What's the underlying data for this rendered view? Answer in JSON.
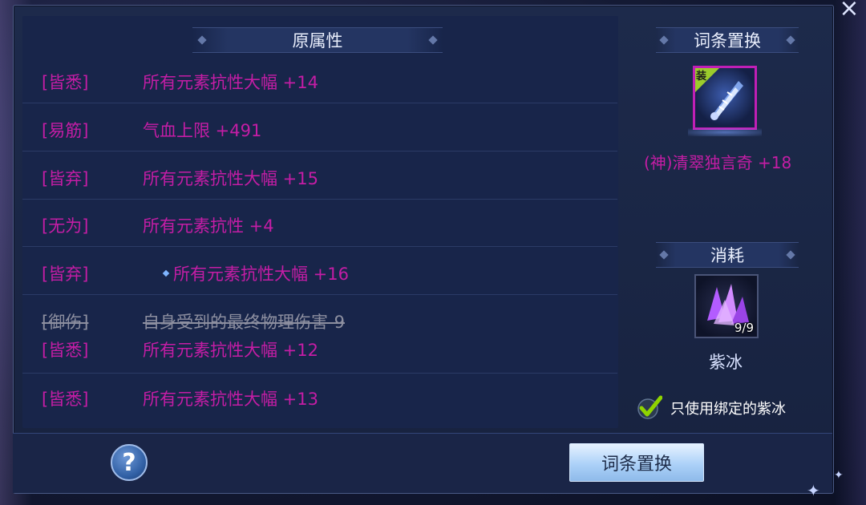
{
  "window": {
    "close_glyph": "×"
  },
  "left_panel": {
    "title": "原属性",
    "rows": [
      {
        "tag": "[皆悉]",
        "attr": "所有元素抗性大幅 +14",
        "struck": false,
        "marked": false
      },
      {
        "tag": "[易筋]",
        "attr": "气血上限 +491",
        "struck": false,
        "marked": false
      },
      {
        "tag": "[皆弃]",
        "attr": "所有元素抗性大幅 +15",
        "struck": false,
        "marked": false
      },
      {
        "tag": "[无为]",
        "attr": "所有元素抗性 +4",
        "struck": false,
        "marked": false
      },
      {
        "tag": "[皆弃]",
        "attr": "所有元素抗性大幅 +16",
        "struck": false,
        "marked": true
      },
      {
        "tag": "[御伤]",
        "attr": "自身受到的最终物理伤害-9",
        "struck": true,
        "marked": false
      },
      {
        "tag": "[皆悉]",
        "attr": "所有元素抗性大幅 +12",
        "struck": false,
        "marked": false
      },
      {
        "tag": "[皆悉]",
        "attr": "所有元素抗性大幅 +13",
        "struck": false,
        "marked": false
      }
    ]
  },
  "right_panel": {
    "replace_title": "词条置换",
    "equipment": {
      "badge": "装",
      "name": "(神)清翠独言奇 +18",
      "icon": "sword-blade-icon"
    },
    "consume_title": "消耗",
    "consumable": {
      "name": "紫冰",
      "count": "9/9",
      "icon": "purple-crystal-icon"
    },
    "bind_only": {
      "label": "只使用绑定的紫冰",
      "checked": true
    }
  },
  "footer": {
    "help_label": "?",
    "action_button": "词条置换"
  },
  "colors": {
    "attr_text": "#c41da5",
    "panel_bg": "#17223f",
    "button_bg": "#acd1f8",
    "checkbox_green": "#8fd400"
  }
}
